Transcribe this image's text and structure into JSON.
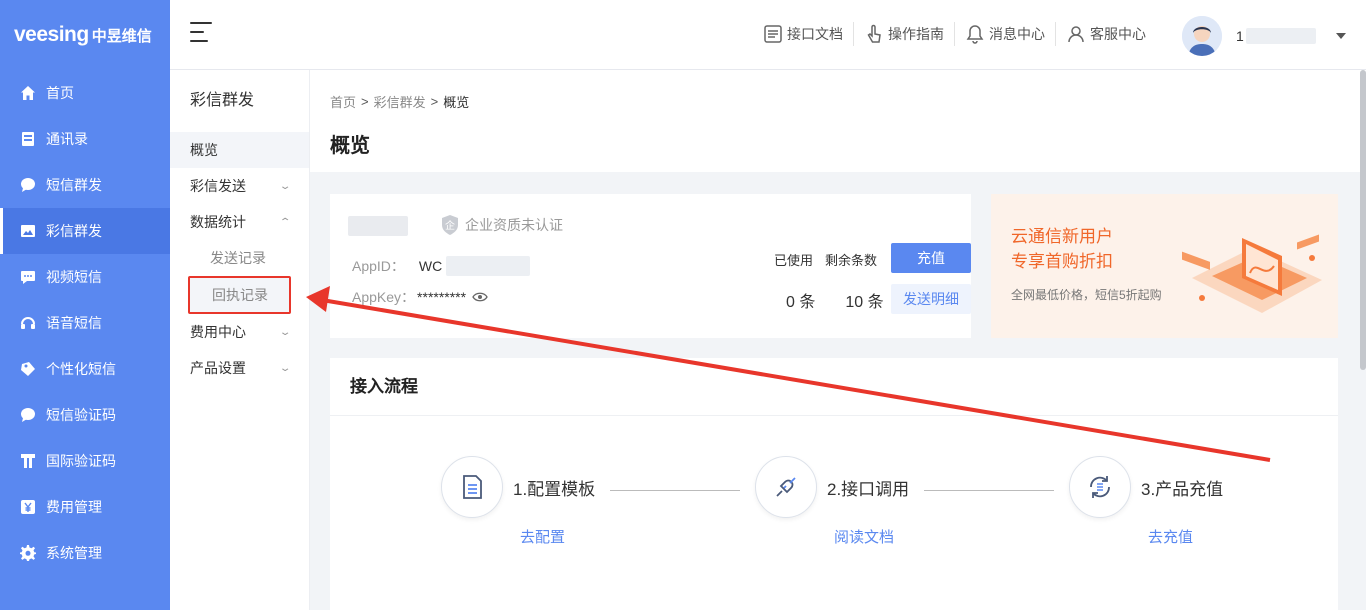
{
  "brand": {
    "latin": "veesing",
    "cn": "中昱维信"
  },
  "sidebar": {
    "items": [
      {
        "label": "首页",
        "icon": "home-icon"
      },
      {
        "label": "通讯录",
        "icon": "contacts-icon"
      },
      {
        "label": "短信群发",
        "icon": "sms-icon"
      },
      {
        "label": "彩信群发",
        "icon": "image-message-icon"
      },
      {
        "label": "视频短信",
        "icon": "video-message-icon"
      },
      {
        "label": "语音短信",
        "icon": "voice-message-icon"
      },
      {
        "label": "个性化短信",
        "icon": "personalized-sms-icon"
      },
      {
        "label": "短信验证码",
        "icon": "sms-code-icon"
      },
      {
        "label": "国际验证码",
        "icon": "international-code-icon"
      },
      {
        "label": "费用管理",
        "icon": "yen-icon"
      },
      {
        "label": "系统管理",
        "icon": "gear-icon"
      }
    ]
  },
  "topbar": {
    "links": [
      {
        "label": "接口文档",
        "icon": "api-doc-icon"
      },
      {
        "label": "操作指南",
        "icon": "hand-pointer-icon"
      },
      {
        "label": "消息中心",
        "icon": "bell-icon"
      },
      {
        "label": "客服中心",
        "icon": "support-icon"
      }
    ],
    "username_prefix": "1"
  },
  "submenu": {
    "title": "彩信群发",
    "overview": "概览",
    "send": "彩信发送",
    "stats": "数据统计",
    "send_records": "发送记录",
    "receipt_records": "回执记录",
    "billing": "费用中心",
    "product_settings": "产品设置"
  },
  "breadcrumb": {
    "home": "首页",
    "section": "彩信群发",
    "current": "概览",
    "sep": ">"
  },
  "page": {
    "title": "概览"
  },
  "account": {
    "badge": "企业资质未认证",
    "appid_label": "AppID：",
    "appid_prefix": "WC",
    "appkey_label": "AppKey：",
    "appkey_value": "*********",
    "used_label": "已使用",
    "remaining_label": "剩余条数",
    "used_value": "0 条",
    "remaining_value": "10 条",
    "recharge_button": "充值",
    "detail_button": "发送明细"
  },
  "promo": {
    "line1": "云通信新用户",
    "line2": "专享首购折扣",
    "subtitle": "全网最低价格，短信5折起购"
  },
  "flow": {
    "title": "接入流程",
    "steps": [
      {
        "label": "1.配置模板",
        "link": "去配置",
        "icon": "document-icon"
      },
      {
        "label": "2.接口调用",
        "link": "阅读文档",
        "icon": "plug-icon"
      },
      {
        "label": "3.产品充值",
        "link": "去充值",
        "icon": "refresh-icon"
      }
    ]
  },
  "colors": {
    "brand": "#5a88f0",
    "annotation": "#e8362b",
    "promo_accent": "#f0672a"
  }
}
